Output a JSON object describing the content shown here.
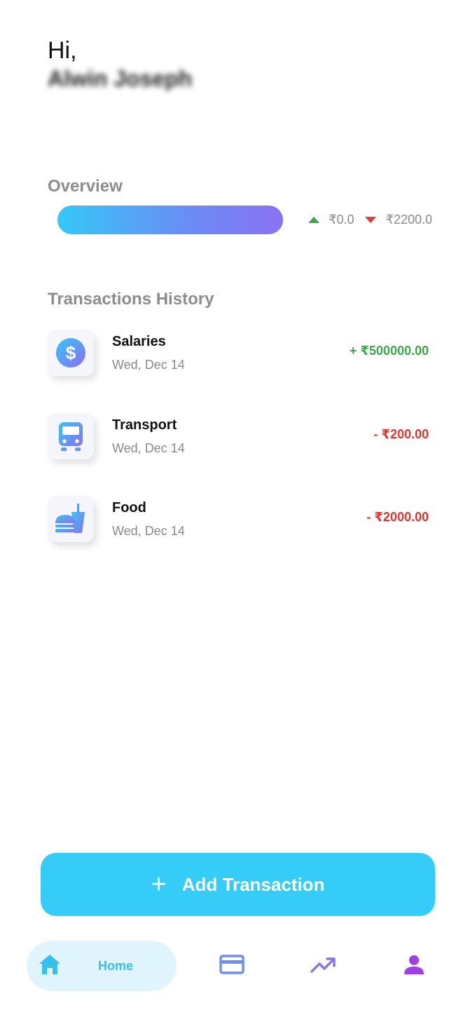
{
  "greeting": {
    "hi": "Hi,",
    "name": "Alwin Joseph"
  },
  "overview": {
    "title": "Overview",
    "income": "₹0.0",
    "expense": "₹2200.0",
    "colors": {
      "bar_start": "#34c8f7",
      "bar_end": "#8b72f3",
      "up": "#3fa34d",
      "down": "#e53935"
    }
  },
  "history": {
    "title": "Transactions History",
    "items": [
      {
        "name": "Salaries",
        "date": "Wed, Dec 14",
        "amount": "+ ₹500000.00",
        "type": "income",
        "icon": "dollar-icon"
      },
      {
        "name": "Transport",
        "date": "Wed, Dec 14",
        "amount": "- ₹200.00",
        "type": "expense",
        "icon": "bus-icon"
      },
      {
        "name": "Food",
        "date": "Wed, Dec 14",
        "amount": "- ₹2000.00",
        "type": "expense",
        "icon": "fastfood-icon"
      }
    ]
  },
  "actions": {
    "add_plus": "+",
    "add_label": "Add Transaction"
  },
  "nav": {
    "home_label": "Home",
    "items": [
      "home-icon",
      "card-icon",
      "trending-up-icon",
      "person-icon"
    ],
    "accent": "#35cdf8"
  }
}
